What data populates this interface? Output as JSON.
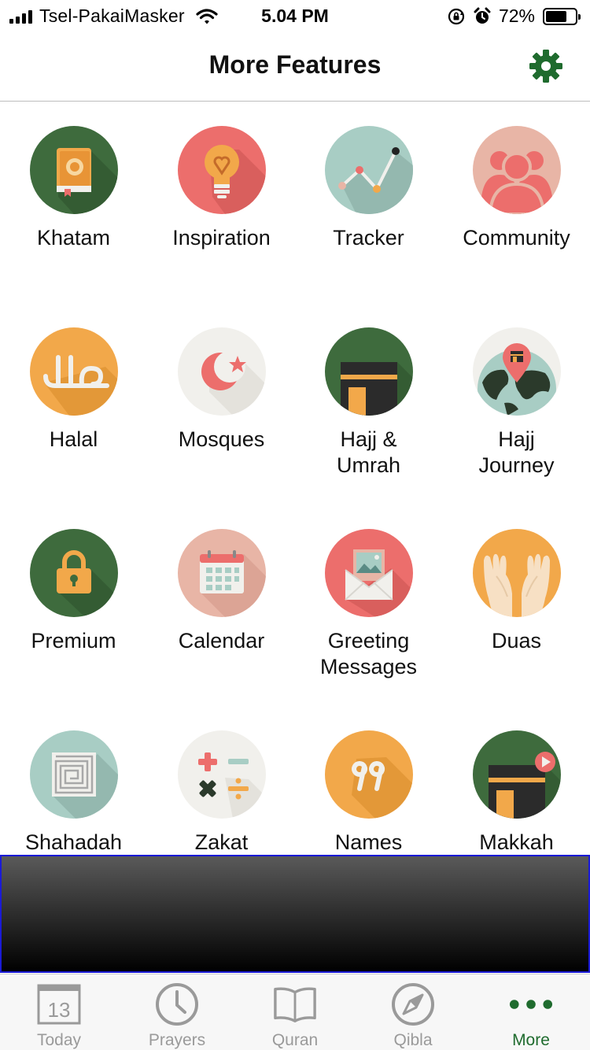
{
  "status_bar": {
    "carrier": "Tsel-PakaiMasker",
    "time": "5.04 PM",
    "battery_percent": "72%",
    "battery_level": 0.72
  },
  "header": {
    "title": "More Features",
    "settings_icon": "gear-icon",
    "accent_color": "#1f6b2e"
  },
  "features": [
    {
      "label": "Khatam",
      "icon": "quran-book-icon",
      "bg": "#3e6b3d"
    },
    {
      "label": "Inspiration",
      "icon": "lightbulb-heart-icon",
      "bg": "#ec6e6c"
    },
    {
      "label": "Tracker",
      "icon": "line-chart-icon",
      "bg": "#a8cdc4"
    },
    {
      "label": "Community",
      "icon": "people-group-icon",
      "bg": "#e8b5a6"
    },
    {
      "label": "Halal",
      "icon": "halal-arabic-icon",
      "bg": "#f2a84a"
    },
    {
      "label": "Mosques",
      "icon": "crescent-star-icon",
      "bg": "#f1f0ec"
    },
    {
      "label": "Hajj &\nUmrah",
      "icon": "kaaba-icon",
      "bg": "#3e6b3d"
    },
    {
      "label": "Hajj\nJourney",
      "icon": "globe-pin-icon",
      "bg": "#f1f0ec"
    },
    {
      "label": "Premium",
      "icon": "padlock-icon",
      "bg": "#3e6b3d"
    },
    {
      "label": "Calendar",
      "icon": "calendar-icon",
      "bg": "#e8b5a6"
    },
    {
      "label": "Greeting\nMessages",
      "icon": "envelope-card-icon",
      "bg": "#ec6e6c"
    },
    {
      "label": "Duas",
      "icon": "praying-hands-icon",
      "bg": "#f2a84a"
    },
    {
      "label": "Shahadah",
      "icon": "kufic-calligraphy-icon",
      "bg": "#a8cdc4"
    },
    {
      "label": "Zakat",
      "icon": "calculator-symbols-icon",
      "bg": "#f1f0ec"
    },
    {
      "label": "Names",
      "icon": "arabic-99-icon",
      "bg": "#f2a84a"
    },
    {
      "label": "Makkah",
      "icon": "kaaba-video-icon",
      "bg": "#3e6b3d"
    }
  ],
  "ad_banner": {
    "border_color": "#1a1ad6"
  },
  "tab_bar": {
    "calendar_day": "13",
    "tabs": [
      {
        "label": "Today",
        "icon": "calendar-day-icon"
      },
      {
        "label": "Prayers",
        "icon": "clock-icon"
      },
      {
        "label": "Quran",
        "icon": "open-book-icon"
      },
      {
        "label": "Qibla",
        "icon": "compass-icon"
      },
      {
        "label": "More",
        "icon": "more-dots-icon",
        "active": true
      }
    ]
  }
}
